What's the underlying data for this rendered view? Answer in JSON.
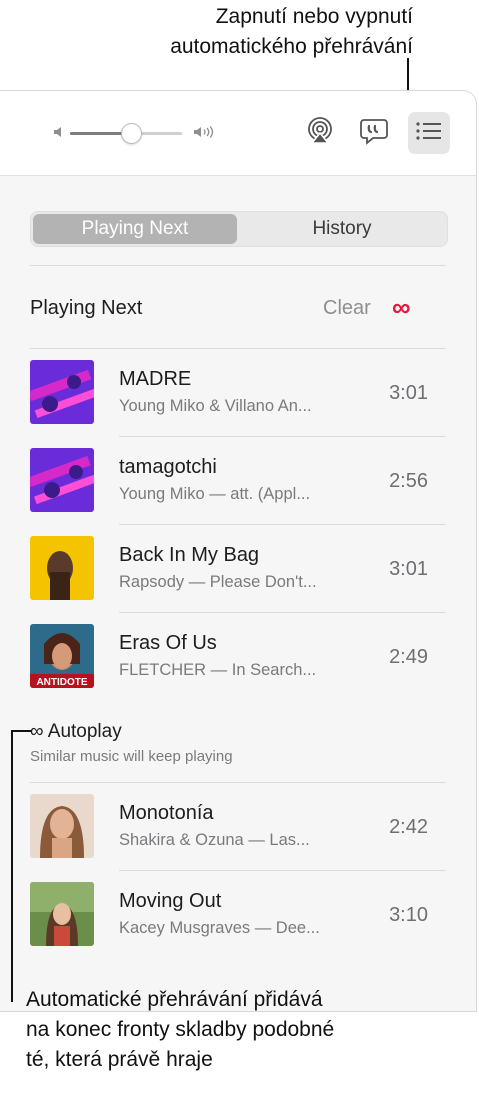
{
  "callouts": {
    "top_line1": "Zapnutí nebo vypnutí",
    "top_line2": "automatického přehrávání",
    "bottom_line1": "Automatické přehrávání přidává",
    "bottom_line2": "na konec fronty skladby podobné",
    "bottom_line3": "té, která právě hraje"
  },
  "toolbar": {
    "volume_level": 0.55,
    "volume_min_icon": "speaker-low-icon",
    "volume_max_icon": "speaker-high-icon",
    "airplay_icon": "airplay-icon",
    "lyrics_icon": "lyrics-icon",
    "queue_icon": "playing-next-list-icon"
  },
  "tabs": {
    "playing_next": "Playing Next",
    "history": "History"
  },
  "queue": {
    "title": "Playing Next",
    "clear": "Clear",
    "autoplay_symbol": "∞",
    "tracks": [
      {
        "title": "MADRE",
        "subtitle": "Young Miko & Villano An...",
        "duration": "3:01"
      },
      {
        "title": "tamagotchi",
        "subtitle": "Young Miko — att. (Appl...",
        "duration": "2:56"
      },
      {
        "title": "Back In My Bag",
        "subtitle": "Rapsody — Please Don't...",
        "duration": "3:01"
      },
      {
        "title": "Eras Of Us",
        "subtitle": "FLETCHER — In Search...",
        "duration": "2:49"
      }
    ]
  },
  "autoplay": {
    "title": "Autoplay",
    "symbol": "∞",
    "subtitle": "Similar music will keep playing",
    "tracks": [
      {
        "title": "Monotonía",
        "subtitle": "Shakira & Ozuna — Las...",
        "duration": "2:42"
      },
      {
        "title": "Moving Out",
        "subtitle": "Kacey Musgraves — Dee...",
        "duration": "3:10"
      }
    ]
  },
  "colors": {
    "accent": "#e8173c",
    "autoplay_album_magenta": "#8a2be2",
    "album_yellow": "#f5c400"
  },
  "album_art_text": {
    "eras_of_us": "ANTIDOTE"
  }
}
